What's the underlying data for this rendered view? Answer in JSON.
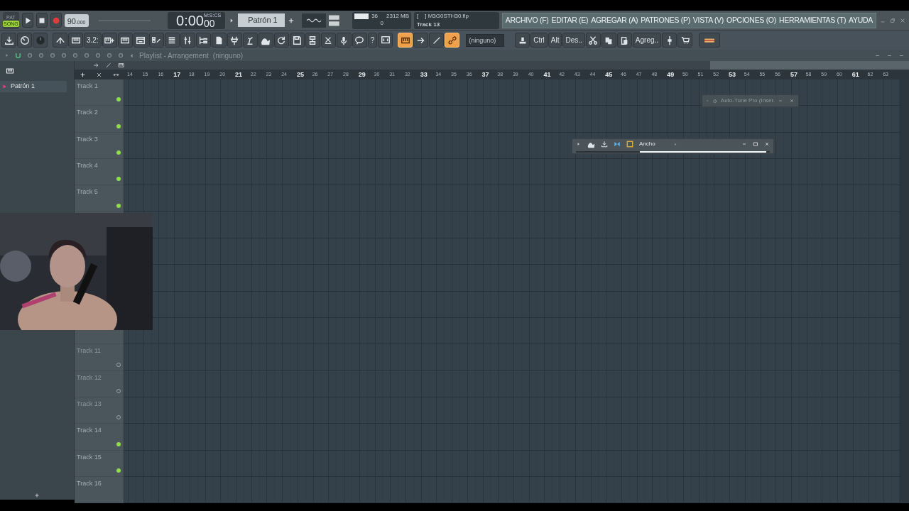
{
  "mode": [
    {
      "label": "PAT",
      "selected": false
    },
    {
      "label": "SONG",
      "selected": true
    }
  ],
  "tempo": {
    "whole": "90",
    "fraction": ".000"
  },
  "time": {
    "value": "0:00",
    "centis": "00",
    "unit": "M:S:CS"
  },
  "pattern": {
    "label": "Patrón 1"
  },
  "monitor": {
    "cpu": "36",
    "memory": "2312 MB",
    "polyphony": "0"
  },
  "hint": {
    "file": "[    ] M3G0STH30.flp",
    "message": "Track 13"
  },
  "menu": [
    "ARCHIVO (F)",
    "EDITAR (E)",
    "AGREGAR (A)",
    "PATRONES (P)",
    "VISTA (V)",
    "OPCIONES (O)",
    "HERRAMIENTAS (T)",
    "AYUDA"
  ],
  "toolbar": [
    {
      "kind": "icon",
      "on": false
    },
    {
      "kind": "icon",
      "on": false
    },
    {
      "kind": "icon",
      "on": false
    },
    {
      "kind": "icon",
      "on": false
    },
    {
      "kind": "icon",
      "on": false
    },
    {
      "kind": "text",
      "label": "3.2:",
      "on": false
    },
    {
      "kind": "icon",
      "on": false
    },
    {
      "kind": "icon",
      "on": false
    },
    {
      "kind": "icon",
      "on": false
    },
    {
      "kind": "icon",
      "on": false
    },
    {
      "kind": "icon",
      "on": false
    },
    {
      "kind": "icon",
      "on": false
    },
    {
      "kind": "icon",
      "on": false
    },
    {
      "kind": "icon",
      "on": false
    },
    {
      "kind": "icon",
      "on": false
    },
    {
      "kind": "icon",
      "on": false
    },
    {
      "kind": "icon",
      "on": false
    },
    {
      "kind": "icon",
      "on": false
    },
    {
      "kind": "icon",
      "on": false
    },
    {
      "kind": "icon",
      "on": false
    },
    {
      "kind": "icon",
      "on": false
    },
    {
      "kind": "icon",
      "on": false
    },
    {
      "kind": "icon",
      "on": false
    },
    {
      "kind": "text",
      "label": "?",
      "on": false
    },
    {
      "kind": "icon",
      "on": false
    },
    {
      "kind": "icon",
      "on": true
    },
    {
      "kind": "icon",
      "on": false
    },
    {
      "kind": "icon",
      "on": false
    },
    {
      "kind": "icon",
      "on": true
    },
    {
      "kind": "field",
      "value": "(ninguno)"
    },
    {
      "kind": "icon",
      "on": false
    },
    {
      "kind": "text",
      "label": "Ctrl",
      "on": false
    },
    {
      "kind": "text",
      "label": "Alt",
      "on": false
    },
    {
      "kind": "text",
      "label": "Des..",
      "on": false
    },
    {
      "kind": "icon",
      "on": false
    },
    {
      "kind": "icon",
      "on": false
    },
    {
      "kind": "icon",
      "on": false
    },
    {
      "kind": "text",
      "label": "Agreg..",
      "on": false
    },
    {
      "kind": "icon",
      "on": false
    },
    {
      "kind": "icon",
      "on": false
    },
    {
      "kind": "icon",
      "on": false
    }
  ],
  "playlist": {
    "title": "Playlist - Arrangement",
    "target": "(ninguno)",
    "ruler": [
      {
        "label": "14",
        "major": false
      },
      {
        "label": "15",
        "major": false
      },
      {
        "label": "16",
        "major": false
      },
      {
        "label": "17",
        "major": true
      },
      {
        "label": "18",
        "major": false
      },
      {
        "label": "19",
        "major": false
      },
      {
        "label": "20",
        "major": false
      },
      {
        "label": "21",
        "major": true
      },
      {
        "label": "22",
        "major": false
      },
      {
        "label": "23",
        "major": false
      },
      {
        "label": "24",
        "major": false
      },
      {
        "label": "25",
        "major": true
      },
      {
        "label": "26",
        "major": false
      },
      {
        "label": "27",
        "major": false
      },
      {
        "label": "28",
        "major": false
      },
      {
        "label": "29",
        "major": true
      },
      {
        "label": "30",
        "major": false
      },
      {
        "label": "31",
        "major": false
      },
      {
        "label": "32",
        "major": false
      },
      {
        "label": "33",
        "major": true
      },
      {
        "label": "34",
        "major": false
      },
      {
        "label": "35",
        "major": false
      },
      {
        "label": "36",
        "major": false
      },
      {
        "label": "37",
        "major": true
      },
      {
        "label": "38",
        "major": false
      },
      {
        "label": "39",
        "major": false
      },
      {
        "label": "40",
        "major": false
      },
      {
        "label": "41",
        "major": true
      },
      {
        "label": "42",
        "major": false
      },
      {
        "label": "43",
        "major": false
      },
      {
        "label": "44",
        "major": false
      },
      {
        "label": "45",
        "major": true
      },
      {
        "label": "46",
        "major": false
      },
      {
        "label": "47",
        "major": false
      },
      {
        "label": "48",
        "major": false
      },
      {
        "label": "49",
        "major": true
      },
      {
        "label": "50",
        "major": false
      },
      {
        "label": "51",
        "major": false
      },
      {
        "label": "52",
        "major": false
      },
      {
        "label": "53",
        "major": true
      },
      {
        "label": "54",
        "major": false
      },
      {
        "label": "55",
        "major": false
      },
      {
        "label": "56",
        "major": false
      },
      {
        "label": "57",
        "major": true
      },
      {
        "label": "58",
        "major": false
      },
      {
        "label": "59",
        "major": false
      },
      {
        "label": "60",
        "major": false
      },
      {
        "label": "61",
        "major": true
      },
      {
        "label": "62",
        "major": false
      },
      {
        "label": "63",
        "major": false
      }
    ],
    "track_groups": [
      [
        {
          "name": "Track 1",
          "enabled": true
        },
        {
          "name": "Track 2",
          "enabled": true
        },
        {
          "name": "Track 3",
          "enabled": true
        },
        {
          "name": "Track 4",
          "enabled": true
        },
        {
          "name": "Track 5",
          "enabled": true
        }
      ],
      [
        {
          "name": "Track 11",
          "enabled": false
        },
        {
          "name": "Track 12",
          "enabled": false
        },
        {
          "name": "Track 13",
          "enabled": false
        },
        {
          "name": "Track 14",
          "enabled": true
        },
        {
          "name": "Track 15",
          "enabled": true
        },
        {
          "name": "Track 16"
        }
      ]
    ]
  },
  "browser": {
    "items": [
      {
        "label": "Patrón 1",
        "selected": true
      }
    ]
  },
  "floating_windows": [
    {
      "kind": "plugin",
      "title": "Auto-Tune Pro (Inser."
    },
    {
      "kind": "tool",
      "title": "Ancho",
      "level": 0.65
    }
  ]
}
